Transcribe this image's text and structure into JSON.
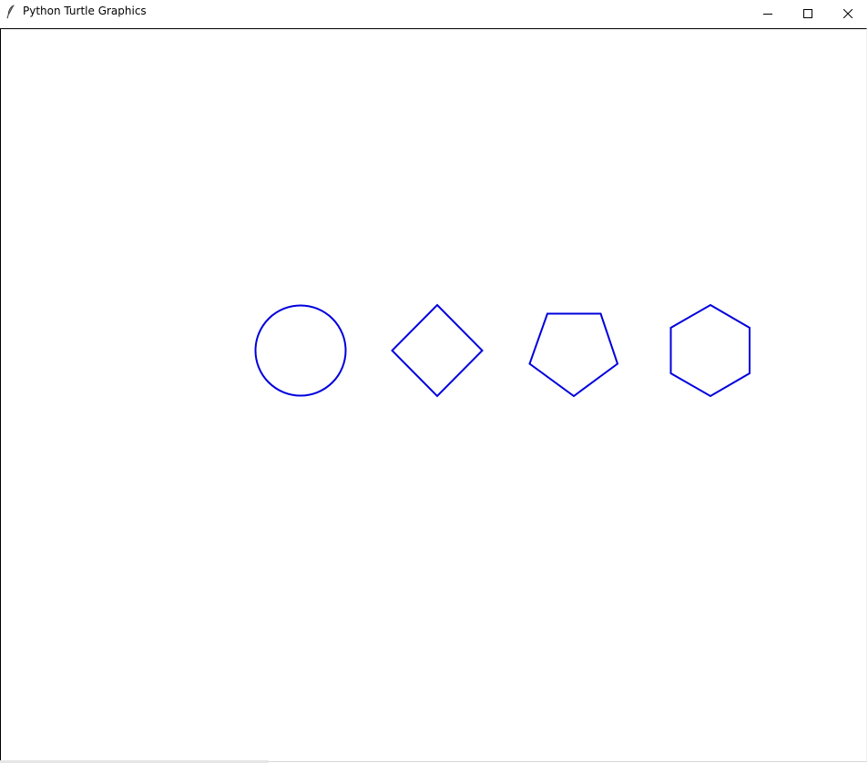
{
  "window": {
    "title": "Python Turtle Graphics",
    "app_icon": "feather-icon",
    "controls": [
      "minimize-icon",
      "maximize-icon",
      "close-icon"
    ]
  },
  "canvas": {
    "background_color": "#ffffff",
    "stroke_color": "#0000dd",
    "shapes": [
      {
        "kind": "circle"
      },
      {
        "kind": "square"
      },
      {
        "kind": "pentagon"
      },
      {
        "kind": "hexagon"
      }
    ]
  }
}
